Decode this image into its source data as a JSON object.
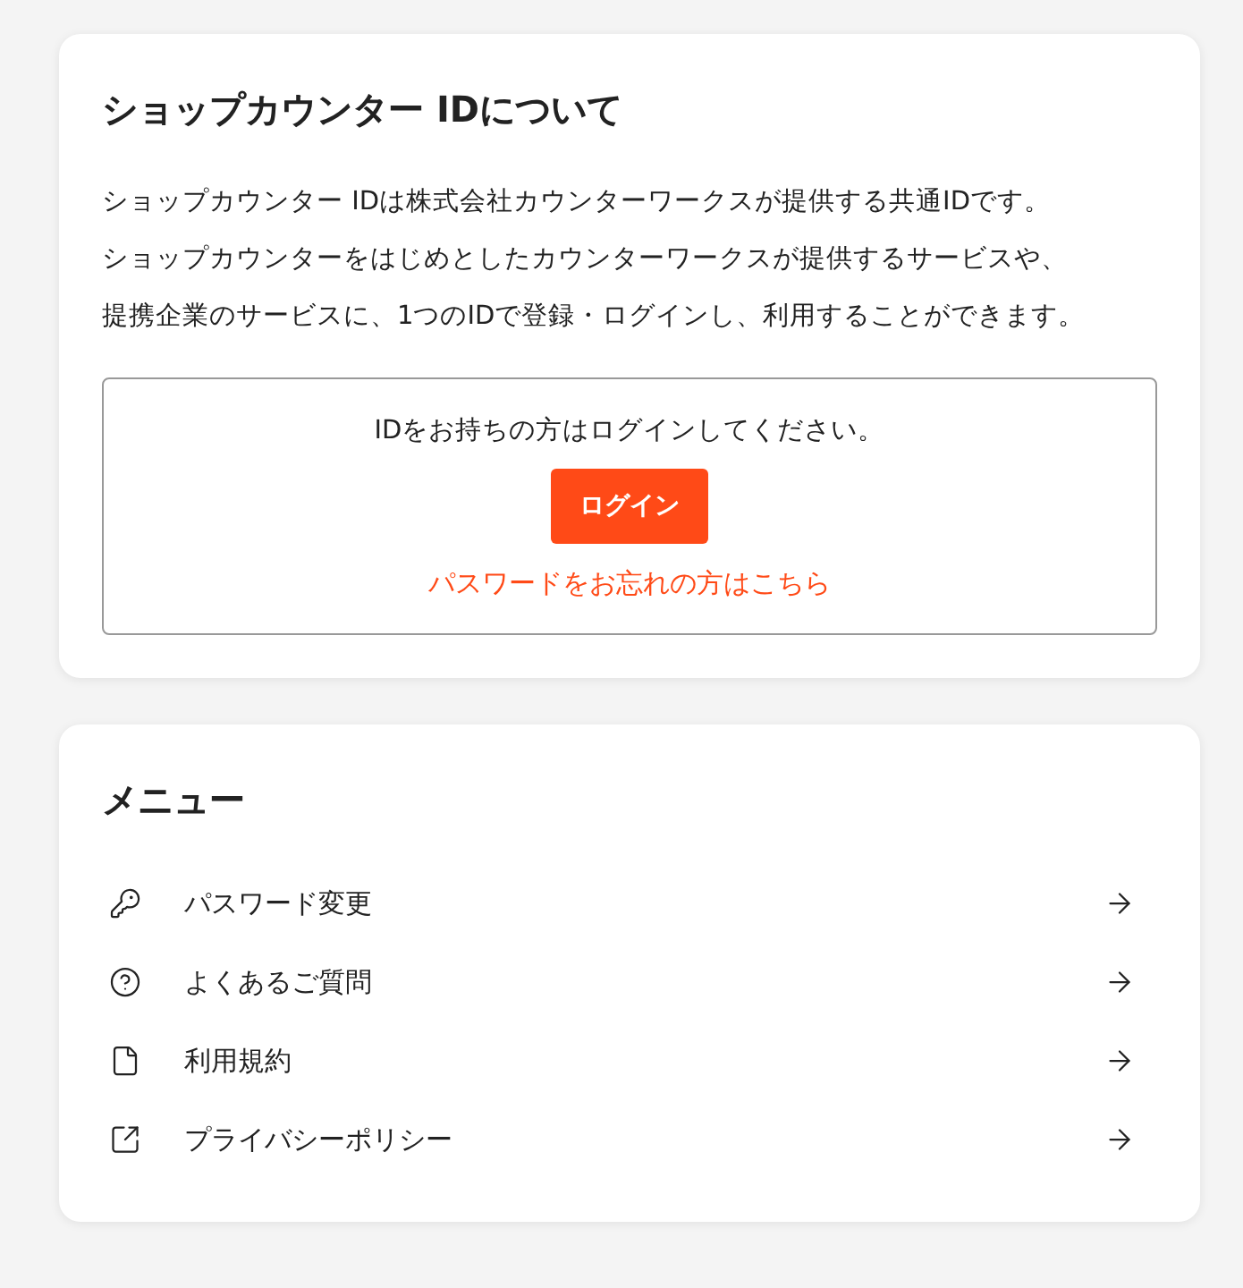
{
  "about": {
    "title": "ショップカウンター IDについて",
    "paragraph": [
      "ショップカウンター IDは株式会社カウンターワークスが提供する共通IDです。",
      "ショップカウンターをはじめとしたカウンターワークスが提供するサービスや、",
      "提携企業のサービスに、1つのIDで登録・ログインし、利用することができます。"
    ],
    "login_box": {
      "prompt": "IDをお持ちの方はログインしてください。",
      "button": "ログイン",
      "forgot_link": "パスワードをお忘れの方はこちら"
    }
  },
  "menu": {
    "title": "メニュー",
    "items": [
      {
        "kind": "key",
        "label": "パスワード変更"
      },
      {
        "kind": "help",
        "label": "よくあるご質問"
      },
      {
        "kind": "document",
        "label": "利用規約"
      },
      {
        "kind": "external",
        "label": "プライバシーポリシー"
      }
    ]
  }
}
